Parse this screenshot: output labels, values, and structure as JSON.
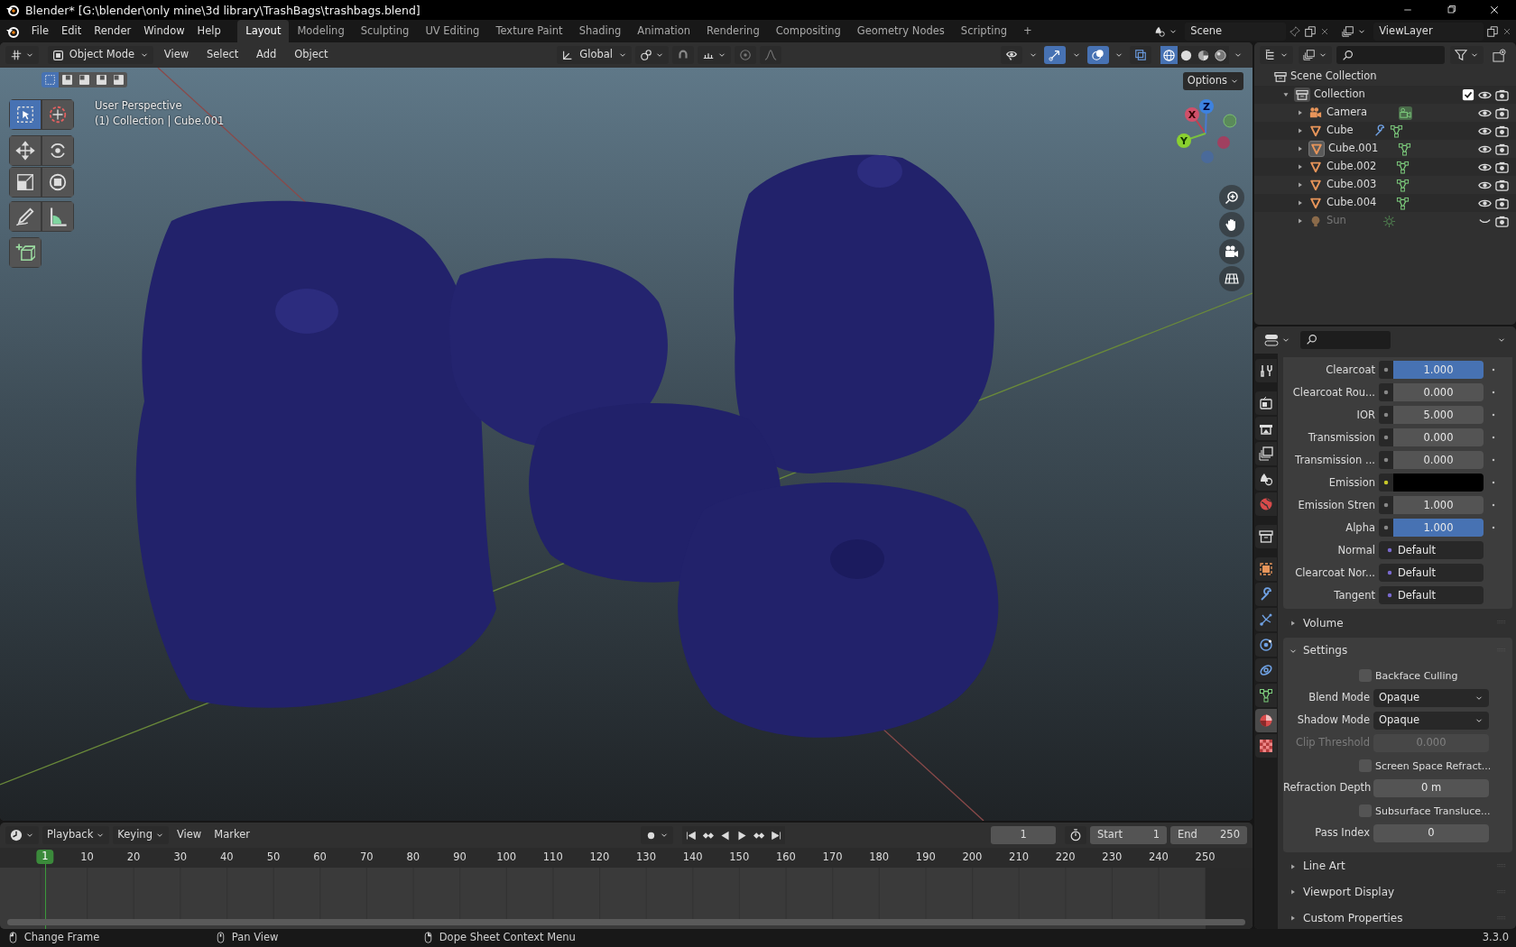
{
  "window": {
    "title": "Blender* [G:\\blender\\only mine\\3d library\\TrashBags\\trashbags.blend]"
  },
  "menu": [
    "File",
    "Edit",
    "Render",
    "Window",
    "Help"
  ],
  "workspaces": [
    {
      "label": "Layout",
      "selected": true
    },
    {
      "label": "Modeling",
      "selected": false
    },
    {
      "label": "Sculpting",
      "selected": false
    },
    {
      "label": "UV Editing",
      "selected": false
    },
    {
      "label": "Texture Paint",
      "selected": false
    },
    {
      "label": "Shading",
      "selected": false
    },
    {
      "label": "Animation",
      "selected": false
    },
    {
      "label": "Rendering",
      "selected": false
    },
    {
      "label": "Compositing",
      "selected": false
    },
    {
      "label": "Geometry Nodes",
      "selected": false
    },
    {
      "label": "Scripting",
      "selected": false
    }
  ],
  "add_workspace": "+",
  "scene": {
    "value": "Scene"
  },
  "view_layer": {
    "value": "ViewLayer"
  },
  "viewport": {
    "mode": "Object Mode",
    "menus": [
      "View",
      "Select",
      "Add",
      "Object"
    ],
    "orientation": "Global",
    "options": "Options",
    "info": [
      "User Perspective",
      "(1) Collection | Cube.001"
    ],
    "gizmo": [
      "X",
      "Y",
      "Z"
    ],
    "select_modes": [
      {
        "selected": true
      },
      {
        "selected": false
      },
      {
        "selected": false
      },
      {
        "selected": false
      },
      {
        "selected": false
      }
    ],
    "toggles": [
      {
        "kind": "visibility",
        "on": false
      },
      {
        "kind": "gizmo",
        "on": true
      },
      {
        "kind": "overlay",
        "on": true
      },
      {
        "kind": "xray",
        "on": false
      }
    ],
    "shading": [
      {
        "kind": "wire",
        "selected": true
      },
      {
        "kind": "solid",
        "selected": false
      },
      {
        "kind": "material",
        "selected": false
      },
      {
        "kind": "rendered",
        "selected": false
      }
    ],
    "tools": [
      {
        "kind": "select",
        "selected": true
      },
      {
        "kind": "cursor",
        "selected": false
      },
      {
        "kind": "move",
        "selected": false
      },
      {
        "kind": "rotate",
        "selected": false
      },
      {
        "kind": "scale",
        "selected": false
      },
      {
        "kind": "transform",
        "selected": false
      },
      {
        "kind": "annotate",
        "selected": false
      },
      {
        "kind": "measure",
        "selected": false
      },
      {
        "kind": "add-cube",
        "selected": false
      }
    ]
  },
  "outliner": {
    "root": "Scene Collection",
    "items": [
      {
        "label": "Collection",
        "kind": "collection",
        "expanded": true,
        "checked": true,
        "children": [
          {
            "label": "Camera",
            "kind": "camera",
            "expanded": false,
            "selected": false,
            "visible": true,
            "modifier": false
          },
          {
            "label": "Cube",
            "kind": "mesh",
            "expanded": false,
            "selected": false,
            "visible": true,
            "modifier": true
          },
          {
            "label": "Cube.001",
            "kind": "mesh",
            "expanded": false,
            "selected": true,
            "visible": true,
            "modifier": false
          },
          {
            "label": "Cube.002",
            "kind": "mesh",
            "expanded": false,
            "selected": false,
            "visible": true,
            "modifier": false
          },
          {
            "label": "Cube.003",
            "kind": "mesh",
            "expanded": false,
            "selected": false,
            "visible": true,
            "modifier": false
          },
          {
            "label": "Cube.004",
            "kind": "mesh",
            "expanded": false,
            "selected": false,
            "visible": true,
            "modifier": false
          },
          {
            "label": "Sun",
            "kind": "light",
            "expanded": false,
            "selected": false,
            "visible": false,
            "modifier": false
          }
        ]
      }
    ]
  },
  "properties": {
    "tabs": [
      {
        "kind": "tool",
        "selected": false
      },
      {
        "kind": "render",
        "selected": false
      },
      {
        "kind": "output",
        "selected": false
      },
      {
        "kind": "view-layer",
        "selected": false
      },
      {
        "kind": "scene",
        "selected": false
      },
      {
        "kind": "world",
        "selected": false
      },
      {
        "kind": "collection",
        "selected": false
      },
      {
        "kind": "object",
        "selected": false
      },
      {
        "kind": "modifier",
        "selected": false
      },
      {
        "kind": "particles",
        "selected": false
      },
      {
        "kind": "physics",
        "selected": false
      },
      {
        "kind": "constraints",
        "selected": false
      },
      {
        "kind": "data",
        "selected": false
      },
      {
        "kind": "material",
        "selected": true
      },
      {
        "kind": "texture",
        "selected": false
      }
    ],
    "rows": [
      {
        "kind": "slider",
        "label": "Clearcoat",
        "value": "1.000",
        "level": 1
      },
      {
        "kind": "slider",
        "label": "Clearcoat Rou...",
        "value": "0.000",
        "level": 0
      },
      {
        "kind": "number",
        "label": "IOR",
        "value": "5.000"
      },
      {
        "kind": "slider",
        "label": "Transmission",
        "value": "0.000",
        "level": 0
      },
      {
        "kind": "slider",
        "label": "Transmission ...",
        "value": "0.000",
        "level": 0
      },
      {
        "kind": "color",
        "label": "Emission",
        "color": "#000000"
      },
      {
        "kind": "number",
        "label": "Emission Stren",
        "value": "1.000"
      },
      {
        "kind": "slider",
        "label": "Alpha",
        "value": "1.000",
        "level": 1
      },
      {
        "kind": "link",
        "label": "Normal",
        "value": "Default"
      },
      {
        "kind": "link",
        "label": "Clearcoat Nor...",
        "value": "Default"
      },
      {
        "kind": "link",
        "label": "Tangent",
        "value": "Default"
      }
    ],
    "panels": [
      {
        "label": "Volume",
        "expanded": false
      },
      {
        "label": "Settings",
        "expanded": true,
        "rows": [
          {
            "kind": "checkbox",
            "label": "Backface Culling",
            "checked": false
          },
          {
            "kind": "dropdown",
            "label": "Blend Mode",
            "value": "Opaque"
          },
          {
            "kind": "dropdown",
            "label": "Shadow Mode",
            "value": "Opaque"
          },
          {
            "kind": "number",
            "label": "Clip Threshold",
            "value": "0.000",
            "disabled": true
          },
          {
            "kind": "checkbox",
            "label": "Screen Space Refract...",
            "checked": false
          },
          {
            "kind": "number",
            "label": "Refraction Depth",
            "value": "0 m",
            "disabled": false
          },
          {
            "kind": "checkbox",
            "label": "Subsurface Transluce...",
            "checked": false
          },
          {
            "kind": "number",
            "label": "Pass Index",
            "value": "0",
            "disabled": false
          }
        ]
      },
      {
        "label": "Line Art",
        "expanded": false
      },
      {
        "label": "Viewport Display",
        "expanded": false
      },
      {
        "label": "Custom Properties",
        "expanded": false
      }
    ]
  },
  "timeline": {
    "menus": [
      "Playback",
      "Keying",
      "View",
      "Marker"
    ],
    "current_frame": "1",
    "start_label": "Start",
    "start": "1",
    "end_label": "End",
    "end": "250",
    "playhead": "1",
    "ruler": [
      "10",
      "20",
      "30",
      "40",
      "50",
      "60",
      "70",
      "80",
      "90",
      "100",
      "110",
      "120",
      "130",
      "140",
      "150",
      "160",
      "170",
      "180",
      "190",
      "200",
      "210",
      "220",
      "230",
      "240",
      "250"
    ]
  },
  "status_bar": {
    "hints": [
      {
        "kind": "left",
        "label": "Change Frame"
      },
      {
        "kind": "middle",
        "label": "Pan View"
      },
      {
        "kind": "right",
        "label": "Dope Sheet Context Menu"
      }
    ],
    "version": "3.3.0"
  }
}
